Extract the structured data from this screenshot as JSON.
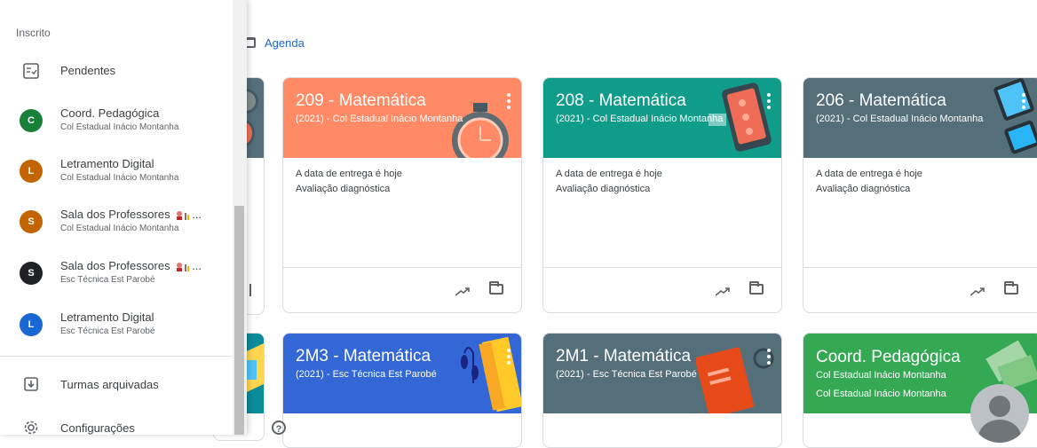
{
  "drawer": {
    "section_heading": "Inscrito",
    "pending": {
      "label": "Pendentes",
      "icon": "pending-list-icon"
    },
    "classes": [
      {
        "initial": "C",
        "name": "Coord. Pedagógica",
        "sub": "Col Estadual Inácio Montanha",
        "color": "#188038"
      },
      {
        "initial": "L",
        "name": "Letramento Digital",
        "sub": "Col Estadual Inácio Montanha",
        "color": "#c26401"
      },
      {
        "initial": "S",
        "name": "Sala dos Professores",
        "sub": "Col Estadual Inácio Montanha",
        "color": "#c26401",
        "suffix": "..."
      },
      {
        "initial": "S",
        "name": "Sala dos Professores",
        "sub": "Esc Técnica Est Parobé",
        "color": "#202124",
        "suffix": "..."
      },
      {
        "initial": "L",
        "name": "Letramento Digital",
        "sub": "Esc Técnica Est Parobé",
        "color": "#1967d2"
      }
    ],
    "archived": {
      "label": "Turmas arquivadas",
      "icon": "archive-icon"
    },
    "settings": {
      "label": "Configurações",
      "icon": "gear-icon"
    }
  },
  "main": {
    "agenda_label": "Agenda",
    "cards": [
      {
        "title": "209 - Matemática",
        "subtitle": "(2021) - Col Estadual Inácio Montanha",
        "color": "#ff8a65",
        "due": "A data de entrega é hoje",
        "assignment": "Avaliação diagnóstica"
      },
      {
        "title": "208 - Matemática",
        "subtitle": "(2021) - Col Estadual Inácio Montanha",
        "color": "#0f9d8a",
        "due": "A data de entrega é hoje",
        "assignment": "Avaliação diagnóstica"
      },
      {
        "title": "206 - Matemática",
        "subtitle": "(2021) - Col Estadual Inácio Montanha",
        "color": "#546e7a",
        "due": "A data de entrega é hoje",
        "assignment": "Avaliação diagnóstica"
      },
      {
        "title": "2M3 - Matemática",
        "subtitle": "(2021) - Esc Técnica Est Parobé",
        "color": "#3367d6"
      },
      {
        "title": "2M1 - Matemática",
        "subtitle": "(2021) - Esc Técnica Est Parobé",
        "color": "#546e7a"
      },
      {
        "title": "Coord. Pedagógica",
        "subtitle": "Col Estadual Inácio Montanha",
        "subtitle2": "Col Estadual Inácio Montanha",
        "color": "#34a853"
      }
    ],
    "help_glyph": "?"
  }
}
